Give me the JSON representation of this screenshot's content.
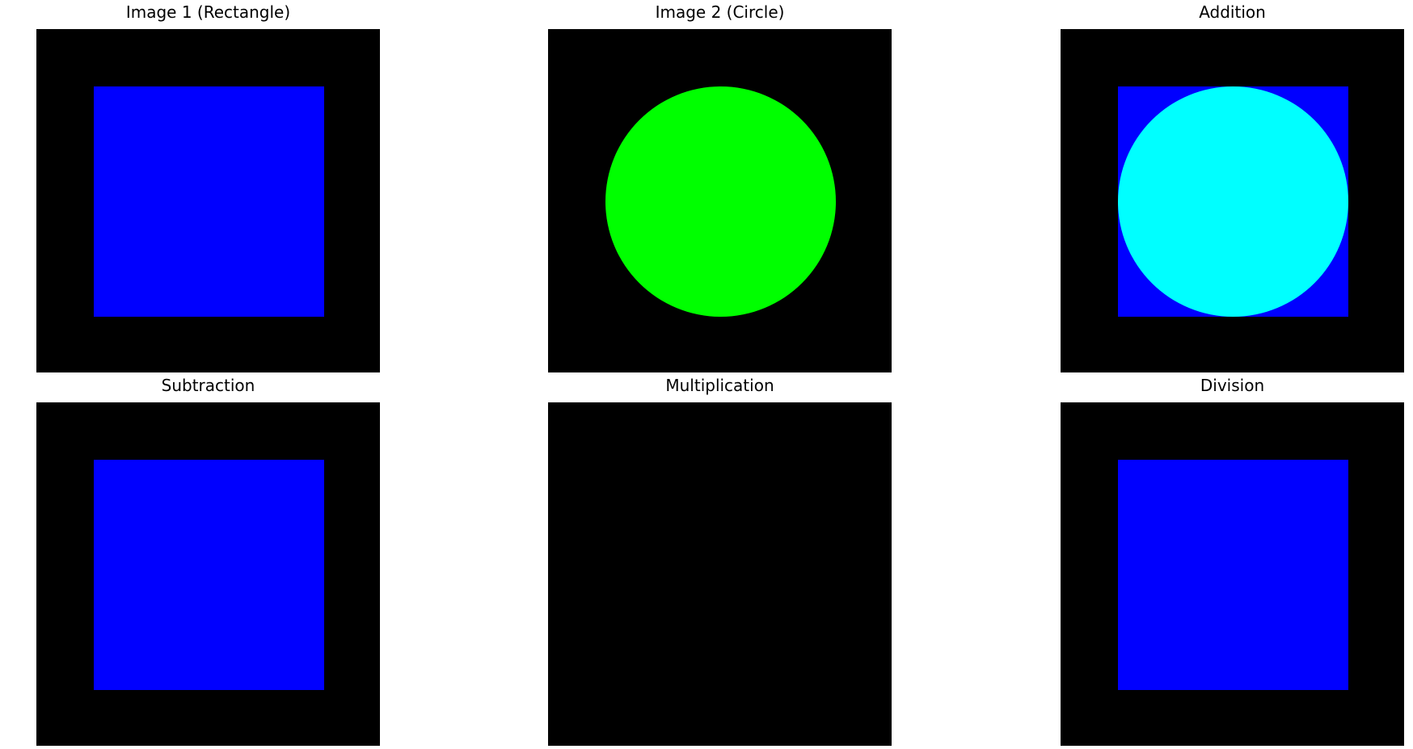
{
  "panels": [
    {
      "title": "Image 1 (Rectangle)",
      "rect_color": "#0000ff",
      "circle_color": null
    },
    {
      "title": "Image 2 (Circle)",
      "rect_color": null,
      "circle_color": "#00ff00"
    },
    {
      "title": "Addition",
      "rect_color": "#0000ff",
      "circle_color": "#00ffff"
    },
    {
      "title": "Subtraction",
      "rect_color": "#0000ff",
      "circle_color": null
    },
    {
      "title": "Multiplication",
      "rect_color": null,
      "circle_color": null
    },
    {
      "title": "Division",
      "rect_color": "#0000ff",
      "circle_color": null
    }
  ],
  "background_color": "#000000"
}
